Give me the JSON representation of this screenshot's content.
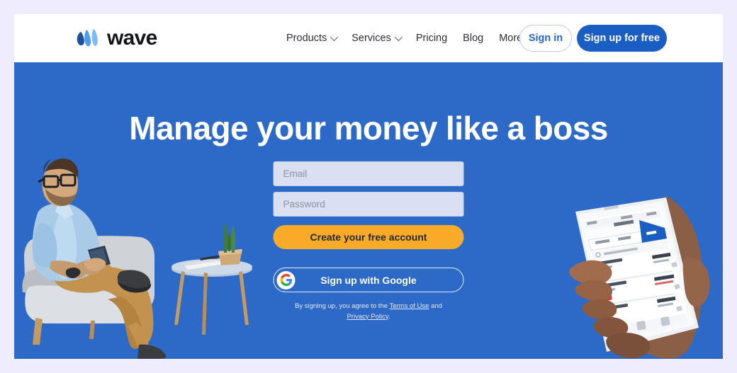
{
  "colors": {
    "page_background": "#efedfd",
    "header_background": "#ffffff",
    "hero_blue": "#2d6ac8",
    "brand_blue": "#1a5ec4",
    "cta_orange": "#f7ab28",
    "input_fill": "#d8e0f1",
    "logo_dark": "#13151a"
  },
  "header": {
    "logo": {
      "icon": "wave-logo-mark",
      "wordmark": "wave"
    },
    "nav": [
      {
        "label": "Products",
        "has_dropdown": true,
        "icon": "chevron-down-icon"
      },
      {
        "label": "Services",
        "has_dropdown": true,
        "icon": "chevron-down-icon"
      },
      {
        "label": "Pricing",
        "has_dropdown": false,
        "icon": ""
      },
      {
        "label": "Blog",
        "has_dropdown": false,
        "icon": ""
      },
      {
        "label": "More",
        "has_dropdown": true,
        "icon": "chevron-down-icon"
      }
    ],
    "sign_in_label": "Sign in",
    "sign_up_label": "Sign up for free"
  },
  "hero": {
    "headline": "Manage your money like a boss",
    "form": {
      "email": {
        "value": "",
        "placeholder": "Email"
      },
      "password": {
        "value": "",
        "placeholder": "Password"
      },
      "submit_label": "Create your free account",
      "google_label": "Sign up with Google",
      "google_icon": "google-g-icon",
      "legal_prefix": "By signing up, you agree to the ",
      "legal_terms_link": "Terms of Use",
      "legal_middle": " and ",
      "legal_privacy_link": "Privacy Policy",
      "legal_suffix": "."
    },
    "left_image": {
      "icon": "photo-man-in-armchair-with-phone",
      "description": "Man with glasses in light blue shirt and tan trousers sitting in a grey armchair using a smartphone, beside a small side table with a potted cactus and notebook"
    },
    "right_image": {
      "icon": "photo-hand-holding-phone-invoices",
      "description": "Hand holding a white smartphone showing the Wave invoices list screen with coloured status badges and dollar amounts"
    }
  }
}
